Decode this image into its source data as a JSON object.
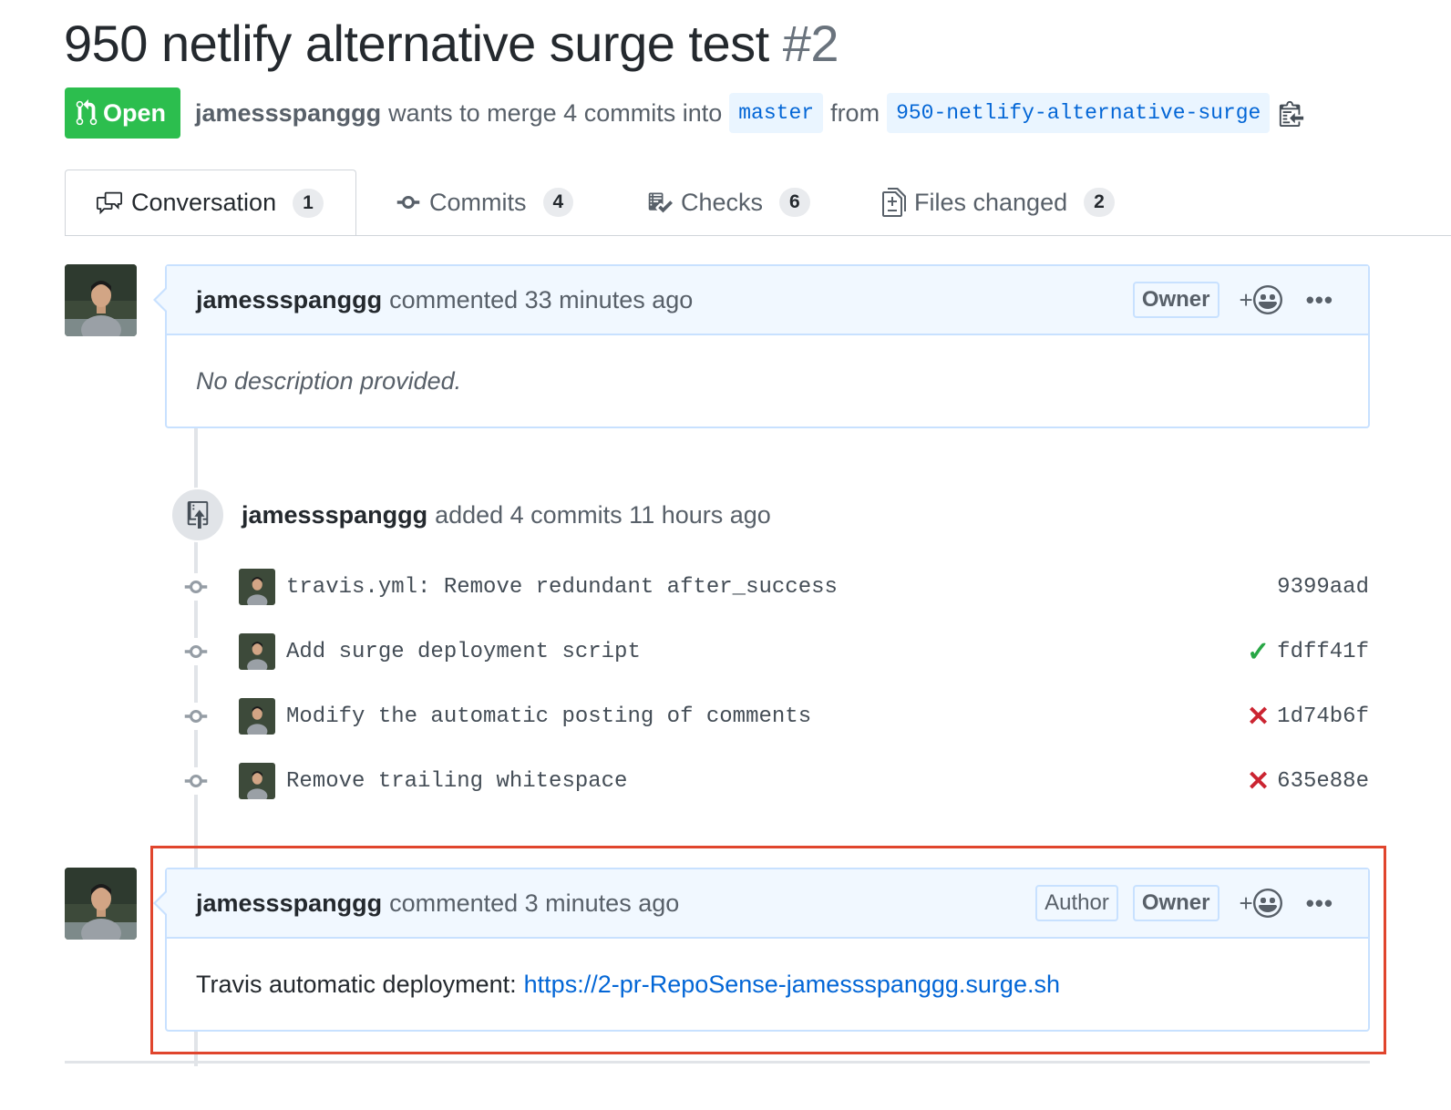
{
  "pr": {
    "title": "950 netlify alternative surge test",
    "number": "#2",
    "state": "Open",
    "author": "jamessspanggg",
    "merge_text": "wants to merge 4 commits into",
    "base_branch": "master",
    "from_text": "from",
    "head_branch": "950-netlify-alternative-surge"
  },
  "tabs": [
    {
      "label": "Conversation",
      "count": "1",
      "icon": "conversation-icon"
    },
    {
      "label": "Commits",
      "count": "4",
      "icon": "commit-icon"
    },
    {
      "label": "Checks",
      "count": "6",
      "icon": "checklist-icon"
    },
    {
      "label": "Files changed",
      "count": "2",
      "icon": "file-diff-icon"
    }
  ],
  "comments": [
    {
      "author": "jamessspanggg",
      "action": "commented 33 minutes ago",
      "labels": [
        "Owner"
      ],
      "body": "No description provided."
    },
    {
      "author": "jamessspanggg",
      "action": "commented 3 minutes ago",
      "labels": [
        "Author",
        "Owner"
      ],
      "body": "Travis automatic deployment:",
      "link": "https://2-pr-RepoSense-jamessspanggg.surge.sh"
    }
  ],
  "commit_event": {
    "author": "jamessspanggg",
    "text": "added 4 commits 11 hours ago"
  },
  "commits": [
    {
      "message": "travis.yml: Remove redundant after_success",
      "sha": "9399aad",
      "status": "none"
    },
    {
      "message": "Add surge deployment script",
      "sha": "fdff41f",
      "status": "success"
    },
    {
      "message": "Modify the automatic posting of comments",
      "sha": "1d74b6f",
      "status": "failure"
    },
    {
      "message": "Remove trailing whitespace",
      "sha": "635e88e",
      "status": "failure"
    }
  ],
  "reaction_label": "+",
  "more_label": "•••",
  "status_glyphs": {
    "success": "✓",
    "failure": "✕"
  },
  "colors": {
    "open": "#2cbe4e",
    "success": "#28a745",
    "failure": "#cb2431",
    "link": "#0366d6",
    "highlight": "#e0452d"
  }
}
